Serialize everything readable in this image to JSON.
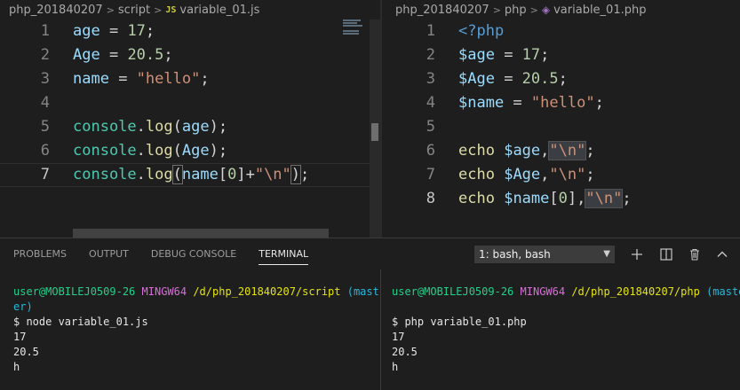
{
  "colors": {
    "background": "#1e1e1e",
    "variable": "#9cdcfe",
    "number": "#b5cea8",
    "string": "#ce9178",
    "function": "#dcdcaa",
    "class": "#4ec9b0",
    "keyword": "#569cd6",
    "terminal_user": "#23d18b",
    "terminal_host": "#d670d6",
    "terminal_path": "#e5e510",
    "terminal_branch": "#29b8db"
  },
  "editor_left": {
    "breadcrumb": {
      "folder": "php_201840207",
      "subfolder": "script",
      "file_icon": "JS",
      "file": "variable_01.js"
    },
    "lines": [
      {
        "num": "1",
        "v1": "age",
        "op": " = ",
        "val": "17",
        "end": ";"
      },
      {
        "num": "2",
        "v1": "Age",
        "op": " = ",
        "val": "20.5",
        "end": ";"
      },
      {
        "num": "3",
        "v1": "name",
        "op": " = ",
        "val": "\"hello\"",
        "end": ";"
      },
      {
        "num": "4"
      },
      {
        "num": "5",
        "obj": "console",
        "dot": ".",
        "fn": "log",
        "open": "(",
        "arg": "age",
        "close": ");"
      },
      {
        "num": "6",
        "obj": "console",
        "dot": ".",
        "fn": "log",
        "open": "(",
        "arg": "Age",
        "close": ");"
      },
      {
        "num": "7",
        "obj": "console",
        "dot": ".",
        "fn": "log",
        "open": "(",
        "arg": "name",
        "idx_open": "[",
        "idx": "0",
        "idx_close": "]",
        "plus": "+",
        "str": "\"\\n\"",
        "close_paren": ")",
        "end": ";"
      }
    ]
  },
  "editor_right": {
    "breadcrumb": {
      "folder": "php_201840207",
      "subfolder": "php",
      "file_icon": "php-elephant-icon",
      "file": "variable_01.php"
    },
    "lines": [
      {
        "num": "1",
        "tag": "<?php"
      },
      {
        "num": "2",
        "v1": "$age",
        "op": " = ",
        "val": "17",
        "end": ";"
      },
      {
        "num": "3",
        "v1": "$Age",
        "op": " = ",
        "val": "20.5",
        "end": ";"
      },
      {
        "num": "4",
        "v1": "$name",
        "op": " = ",
        "val": "\"hello\"",
        "end": ";"
      },
      {
        "num": "5"
      },
      {
        "num": "6",
        "kw": "echo",
        "sp": " ",
        "var": "$age",
        "comma": ",",
        "str": "\"\\n\"",
        "end": ";"
      },
      {
        "num": "7",
        "kw": "echo",
        "sp": " ",
        "var": "$Age",
        "comma": ",",
        "str": "\"\\n\"",
        "end": ";"
      },
      {
        "num": "8",
        "kw": "echo",
        "sp": " ",
        "var": "$name",
        "idx_open": "[",
        "idx": "0",
        "idx_close": "]",
        "comma": ",",
        "str": "\"\\n\"",
        "end": ";"
      }
    ]
  },
  "panel": {
    "tabs": [
      "PROBLEMS",
      "OUTPUT",
      "DEBUG CONSOLE",
      "TERMINAL"
    ],
    "active_tab": "TERMINAL",
    "terminal_select": "1: bash, bash",
    "icons": [
      "plus-icon",
      "split-icon",
      "trash-icon",
      "chevron-up-icon"
    ]
  },
  "terminal_left": {
    "user": "user@MOBILEJ0509-26",
    "host": "MINGW64",
    "path": "/d/php_201840207/script",
    "branch_part1": "(mast",
    "branch_part2": "er)",
    "command": "$ node variable_01.js",
    "output": [
      "17",
      "20.5",
      "h"
    ]
  },
  "terminal_right": {
    "user": "user@MOBILEJ0509-26",
    "host": "MINGW64",
    "path": "/d/php_201840207/php",
    "branch": "(master",
    "command": "$ php variable_01.php",
    "output": [
      "17",
      "20.5",
      "h"
    ]
  }
}
